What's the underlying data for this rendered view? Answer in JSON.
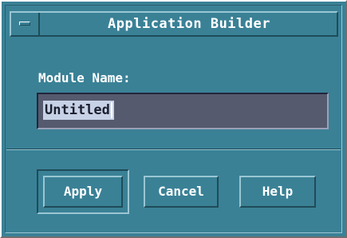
{
  "window": {
    "title": "Application Builder"
  },
  "form": {
    "module_label": "Module Name:",
    "module_value": "Untitled"
  },
  "buttons": {
    "apply": "Apply",
    "cancel": "Cancel",
    "help": "Help"
  },
  "colors": {
    "background": "#3a8196",
    "input_bg": "#555a6e",
    "selection_bg": "#c8d2e6",
    "text": "#ffffff"
  }
}
